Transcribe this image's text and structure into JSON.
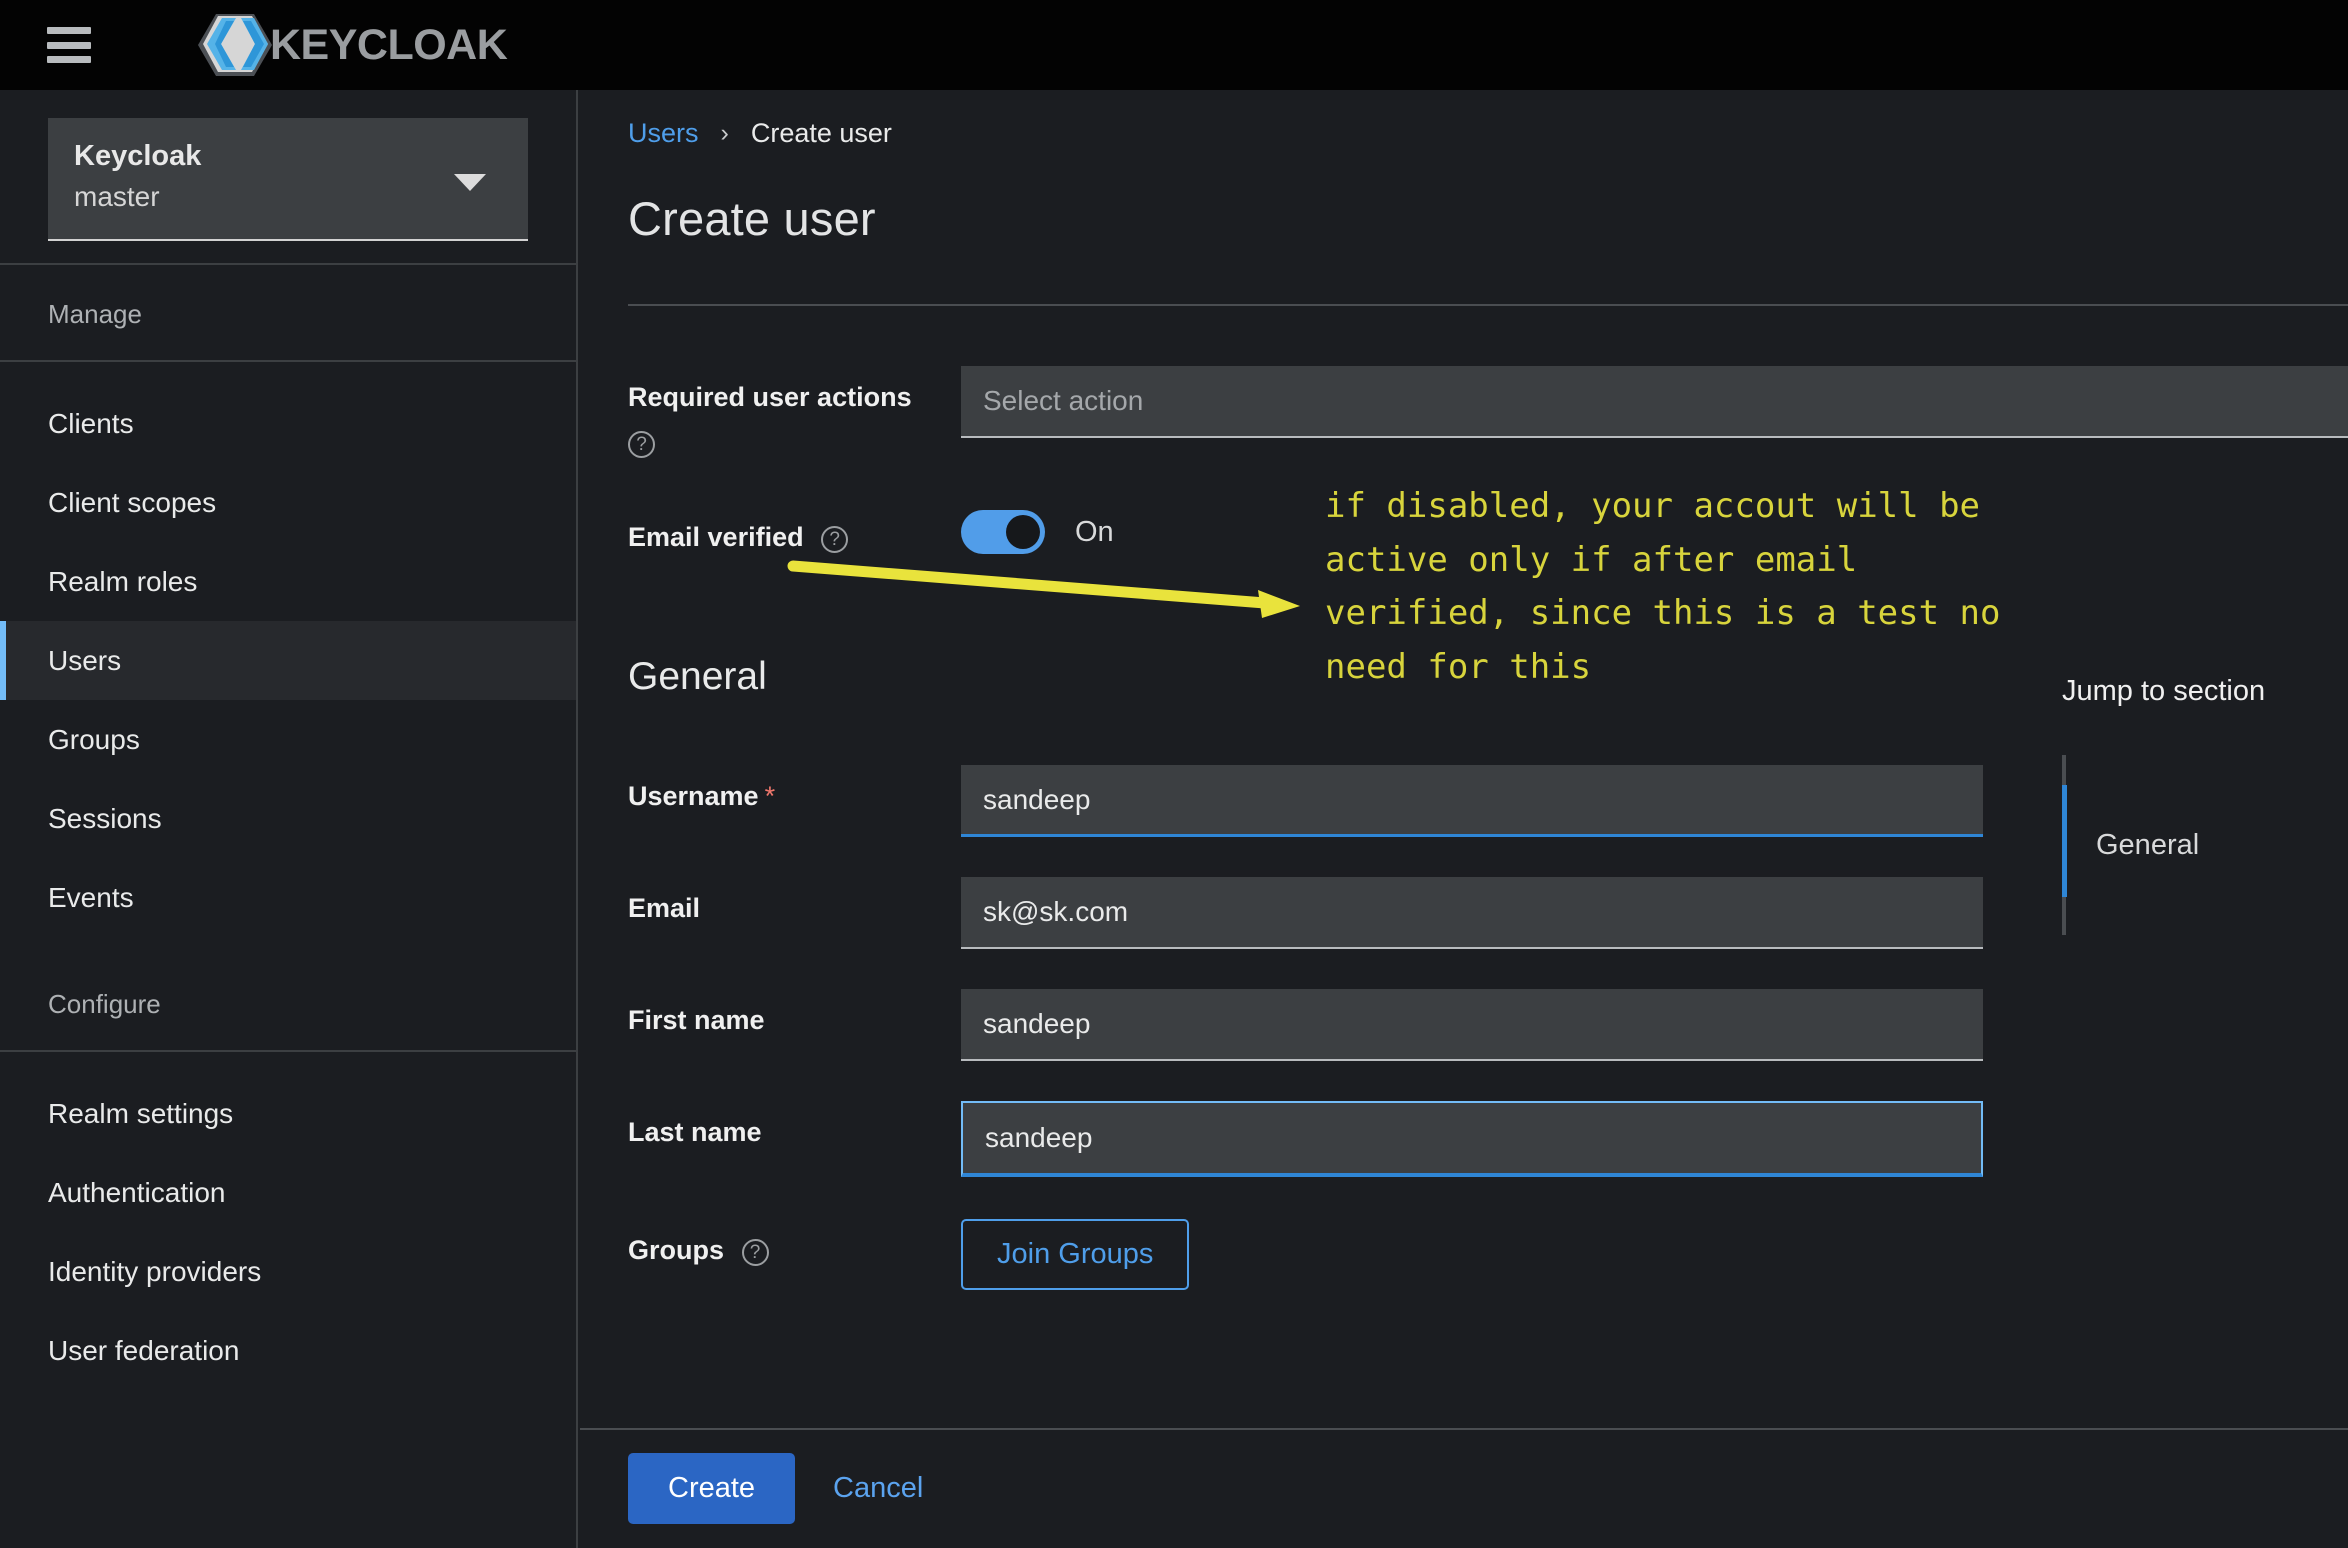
{
  "masthead": {
    "menu_icon": "hamburger-icon",
    "logo_icon": "keycloak-logo-icon",
    "brand": "KEYCLOAK"
  },
  "sidebar": {
    "realm_selector": {
      "title": "Keycloak",
      "realm": "master",
      "caret_icon": "chevron-down-icon"
    },
    "groups": [
      {
        "title": "Manage",
        "items": [
          {
            "label": "Clients",
            "active": false
          },
          {
            "label": "Client scopes",
            "active": false
          },
          {
            "label": "Realm roles",
            "active": false
          },
          {
            "label": "Users",
            "active": true
          },
          {
            "label": "Groups",
            "active": false
          },
          {
            "label": "Sessions",
            "active": false
          },
          {
            "label": "Events",
            "active": false
          }
        ]
      },
      {
        "title": "Configure",
        "items": [
          {
            "label": "Realm settings",
            "active": false
          },
          {
            "label": "Authentication",
            "active": false
          },
          {
            "label": "Identity providers",
            "active": false
          },
          {
            "label": "User federation",
            "active": false
          }
        ]
      }
    ]
  },
  "main": {
    "breadcrumb": {
      "parent": "Users",
      "separator": "›",
      "current": "Create user"
    },
    "page_title": "Create user",
    "form": {
      "required_user_actions": {
        "label": "Required user actions",
        "help_icon": "help-circle-icon",
        "placeholder": "Select action",
        "value": ""
      },
      "email_verified": {
        "label": "Email verified",
        "help_icon": "help-circle-icon",
        "toggle_state": "On",
        "toggle_on": true
      },
      "section_general": "General",
      "username": {
        "label": "Username",
        "required_marker": "*",
        "value": "sandeep"
      },
      "email": {
        "label": "Email",
        "value": "sk@sk.com"
      },
      "first_name": {
        "label": "First name",
        "value": "sandeep"
      },
      "last_name": {
        "label": "Last name",
        "value": "sandeep"
      },
      "groups": {
        "label": "Groups",
        "help_icon": "help-circle-icon",
        "join_button": "Join Groups"
      }
    },
    "jump_to_section": {
      "title": "Jump to section",
      "items": [
        "General"
      ]
    },
    "footer": {
      "create_label": "Create",
      "cancel_label": "Cancel"
    }
  },
  "annotation": {
    "text": "if disabled, your accout will be\nactive only if after email\nverified, since this is a test no\nneed for this",
    "color": "#d8d43c",
    "arrow_icon": "arrow-right-icon"
  },
  "colors": {
    "accent_blue": "#2f86d6",
    "link_blue": "#4f9eea",
    "toggle_on": "#519de9",
    "annotation_yellow": "#d8d43c",
    "required_red": "#f0776c",
    "sidebar_bg": "#1b1d21",
    "field_bg": "#3c3f42",
    "masthead_bg": "#030303"
  }
}
